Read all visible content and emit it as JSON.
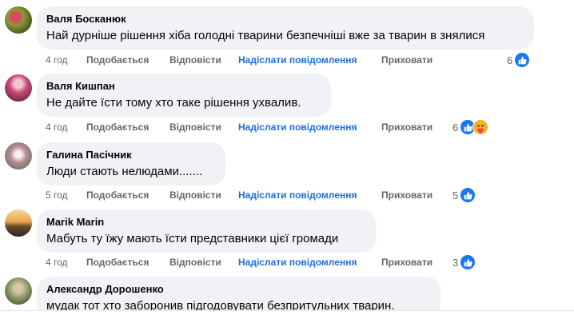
{
  "comments": [
    {
      "author": "Валя Босканюк",
      "text": "Най дурніше рішення хіба голодні тварини безпечніші вже за тварин в знялися",
      "time": "4 год",
      "like_label": "Подобається",
      "reply_label": "Відповісти",
      "message_label": "Надіслати повідомлення",
      "hide_label": "Приховати",
      "reaction_count": "6",
      "reactions": [
        "like-icon"
      ]
    },
    {
      "author": "Валя Кишпан",
      "text": "Не дайте їсти тому хто таке рішення ухвалив.",
      "time": "4 год",
      "like_label": "Подобається",
      "reply_label": "Відповісти",
      "message_label": "Надіслати повідомлення",
      "hide_label": "Приховати",
      "reaction_count": "6",
      "reactions": [
        "like-icon",
        "care-icon"
      ]
    },
    {
      "author": "Галина Пасічник",
      "text": "Люди стають нелюдами.......",
      "time": "5 год",
      "like_label": "Подобається",
      "reply_label": "Відповісти",
      "message_label": "Надіслати повідомлення",
      "hide_label": "Приховати",
      "reaction_count": "5",
      "reactions": [
        "like-icon"
      ]
    },
    {
      "author": "Marik Marin",
      "text": "Мабуть ту їжу мають їсти представники цієї громади",
      "time": "4 год",
      "like_label": "Подобається",
      "reply_label": "Відповісти",
      "message_label": "Надіслати повідомлення",
      "hide_label": "Приховати",
      "reaction_count": "3",
      "reactions": [
        "like-icon"
      ]
    },
    {
      "author": "Александр Дорошенко",
      "text": "мудак тот хто заборонив підгодовувати безпритульних тварин.",
      "time": "",
      "like_label": "",
      "reply_label": "",
      "message_label": "",
      "hide_label": "",
      "reaction_count": "",
      "reactions": []
    }
  ],
  "colors": {
    "bubble_bg": "#f0f2f5",
    "action_text": "#65676b",
    "message_link": "#1d6ed8",
    "like_blue": "#1877f2"
  }
}
